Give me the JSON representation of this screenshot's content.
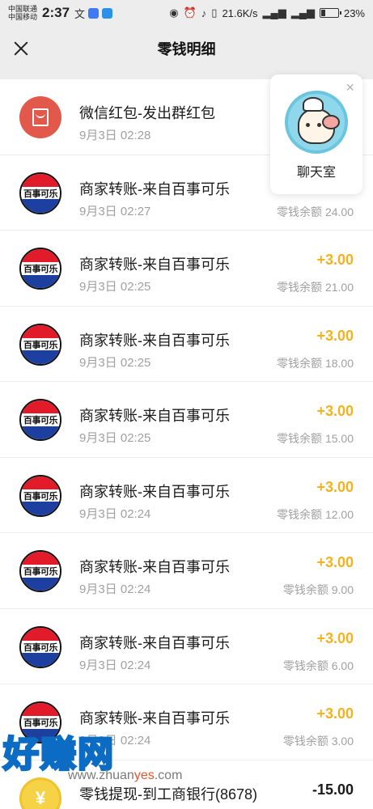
{
  "status_bar": {
    "carrier1": "中国联通",
    "carrier2": "中国移动",
    "time": "2:37",
    "net_speed": "21.6K/s",
    "battery_pct": "23%",
    "battery_level": 0.23
  },
  "nav": {
    "title": "零钱明细"
  },
  "transactions": [
    {
      "title": "微信红包-发出群红包",
      "date": "9月3日 02:28",
      "amount": "",
      "balance": "",
      "icon": "red-packet"
    },
    {
      "title": "商家转账-来自百事可乐",
      "date": "9月3日 02:27",
      "amount": "",
      "balance": "零钱余额 24.00",
      "icon": "pepsi"
    },
    {
      "title": "商家转账-来自百事可乐",
      "date": "9月3日 02:25",
      "amount": "+3.00",
      "balance": "零钱余额 21.00",
      "icon": "pepsi"
    },
    {
      "title": "商家转账-来自百事可乐",
      "date": "9月3日 02:25",
      "amount": "+3.00",
      "balance": "零钱余额 18.00",
      "icon": "pepsi"
    },
    {
      "title": "商家转账-来自百事可乐",
      "date": "9月3日 02:25",
      "amount": "+3.00",
      "balance": "零钱余额 15.00",
      "icon": "pepsi"
    },
    {
      "title": "商家转账-来自百事可乐",
      "date": "9月3日 02:24",
      "amount": "+3.00",
      "balance": "零钱余额 12.00",
      "icon": "pepsi"
    },
    {
      "title": "商家转账-来自百事可乐",
      "date": "9月3日 02:24",
      "amount": "+3.00",
      "balance": "零钱余额 9.00",
      "icon": "pepsi"
    },
    {
      "title": "商家转账-来自百事可乐",
      "date": "9月3日 02:24",
      "amount": "+3.00",
      "balance": "零钱余额 6.00",
      "icon": "pepsi"
    },
    {
      "title": "商家转账-来自百事可乐",
      "date": "9月3日 02:24",
      "amount": "+3.00",
      "balance": "零钱余额 3.00",
      "icon": "pepsi"
    },
    {
      "title": "零钱提现-到工商银行(8678)",
      "date": "",
      "amount": "-15.00",
      "balance": "",
      "icon": "coin"
    }
  ],
  "pepsi_label": "百事可乐",
  "coin_symbol": "¥",
  "chat_float": {
    "label": "聊天室",
    "close": "×"
  },
  "watermark": {
    "main": "好赚网",
    "sub_pre": "www.zhuan",
    "sub_hl": "yes",
    "sub_post": ".com"
  },
  "colors": {
    "income": "#f3b21f",
    "pepsi_red": "#e21b2b",
    "pepsi_blue": "#1d3fa0",
    "red_packet": "#e2584b"
  }
}
